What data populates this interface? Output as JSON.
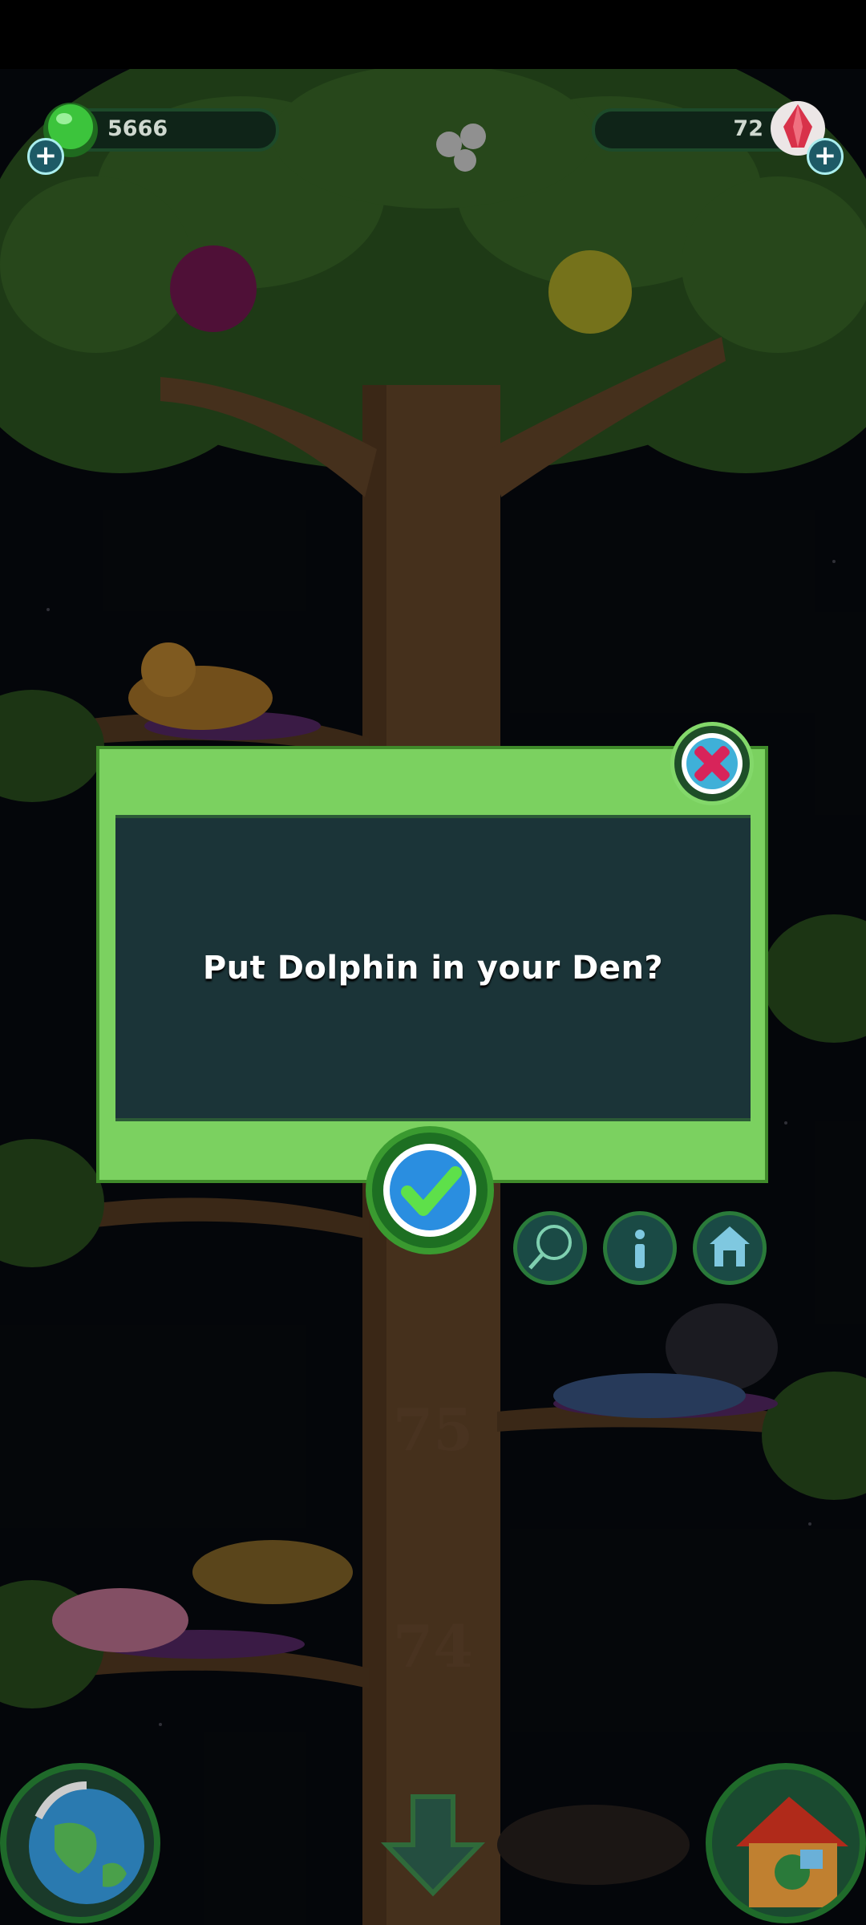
{
  "resources": {
    "left": {
      "value": "5666",
      "icon": "green-gem-icon",
      "color": "#3cc43c"
    },
    "right": {
      "value": "72",
      "icon": "red-crystal-icon",
      "color": "#d8324a"
    }
  },
  "dialog": {
    "message": "Put Dolphin in your Den?",
    "close_icon": "close-icon",
    "confirm_icon": "check-icon"
  },
  "branch_levels": [
    "75",
    "74"
  ],
  "action_buttons": [
    "net-icon",
    "info-icon",
    "den-icon"
  ],
  "corner_buttons": [
    "globe-icon",
    "down-arrow-icon",
    "treehouse-icon"
  ]
}
